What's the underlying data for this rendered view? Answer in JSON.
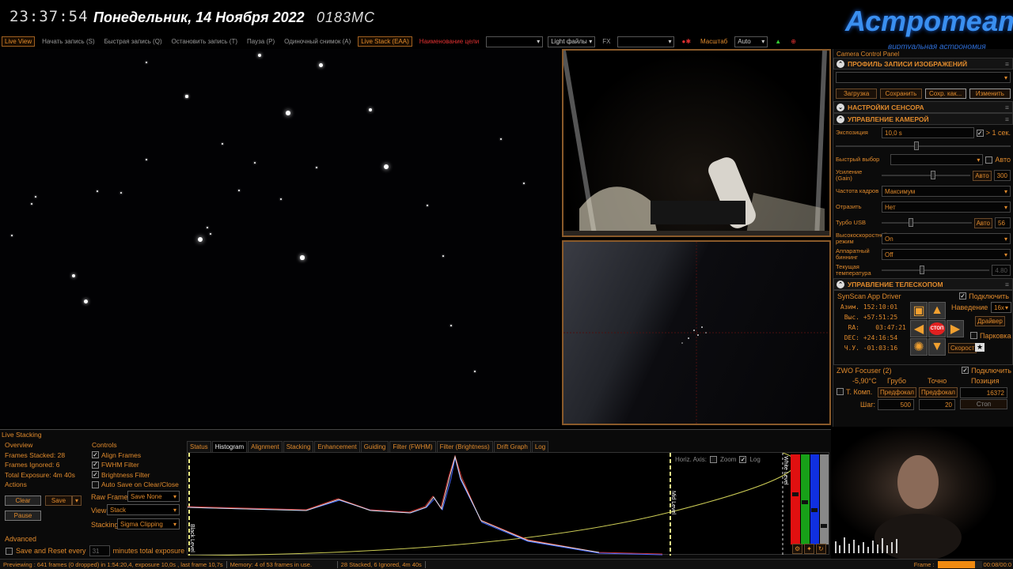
{
  "overlay": {
    "clock": "23:37:54",
    "date": "Понедельник, 14 Ноября 2022",
    "code": "0183МС",
    "logo": "Астротеатр",
    "logo_sub": "виртуальная астрономия"
  },
  "toolbar": {
    "live_view": "Live View",
    "start_rec": "Начать запись (S)",
    "quick_rec": "Быстрая запись (Q)",
    "stop_rec": "Остановить запись (T)",
    "pause": "Пауза (P)",
    "single_shot": "Одиночный снимок (A)",
    "live_stack": "Live Stack (EAA)",
    "target_name": "Наименование цели",
    "target_value": "",
    "light_files": "Light файлы",
    "fx": "FX",
    "fx_value": "",
    "scale_label": "Масштаб",
    "scale_value": "Auto"
  },
  "panel": {
    "title": "Camera Control Panel",
    "profile": {
      "title": "ПРОФИЛЬ ЗАПИСИ ИЗОБРАЖЕНИЙ",
      "value": "",
      "buttons": [
        "Загрузка",
        "Сохранить",
        "Сохр. как...",
        "Изменить"
      ]
    },
    "sensor": {
      "title": "НАСТРОЙКИ СЕНСОРА"
    },
    "camera": {
      "title": "УПРАВЛЕНИЕ КАМЕРОЙ",
      "exposure_label": "Экспозиция",
      "exposure": "10,0 s",
      "gt1_label": "> 1 сек.",
      "quick_label": "Быстрый выбор",
      "quick_value": "",
      "auto_label": "Авто",
      "gain_label": "Усиление (Gain)",
      "gain_auto": "Авто",
      "gain": "300",
      "gain_fraction": 0.55,
      "fps_label": "Частота кадров",
      "fps": "Максимум",
      "flip_label": "Отразить",
      "flip": "Нет",
      "usb_label": "Турбо USB",
      "usb_auto": "Авто",
      "usb": "56",
      "usb_fraction": 0.3,
      "hs_label": "Высокоскоростной режим",
      "hs": "On",
      "bin_label": "Аппаратный биннинг",
      "bin": "Off",
      "temp_label": "Текущая температура",
      "temp": "4.80",
      "temp_fraction": 0.35,
      "exposure_fraction": 0.45
    },
    "telescope": {
      "title": "УПРАВЛЕНИЕ ТЕЛЕСКОПОМ",
      "driver": "SynScan App Driver",
      "connect": "Подключить",
      "az_label": "Азим.",
      "az": "152:10:01",
      "alt_label": "Выс.",
      "alt": "+57:51:25",
      "ra_label": "RA:",
      "ra": "03:47:21",
      "dec_label": "DEC:",
      "dec": "+24:16:54",
      "ha_label": "Ч.У.",
      "ha": "-01:03:16",
      "stop": "СТОП",
      "goto_label": "Наведение",
      "goto_rate": "16x",
      "driver_btn": "Драйвер",
      "park": "Парковка",
      "speed": "Скорост"
    },
    "focuser": {
      "title": "ZWO Focuser (2)",
      "connect": "Подключить",
      "temp": "-5,90°C",
      "coarse": "Грубо",
      "fine": "Точно",
      "position_label": "Позиция",
      "tcomp": "Т. Комп.",
      "prefocal1": "Предфокал",
      "prefocal2": "Предфокал",
      "position": "16372",
      "step_label": "Шаг:",
      "coarse_step": "500",
      "fine_step": "20",
      "stop": "Стоп"
    }
  },
  "stacking": {
    "title": "Live Stacking",
    "overview_label": "Overview",
    "frames_stacked": "Frames Stacked: 28",
    "frames_ignored": "Frames Ignored: 6",
    "total_exposure": "Total Exposure:   4m 40s",
    "actions_label": "Actions",
    "clear": "Clear",
    "save": "Save",
    "pause": "Pause",
    "controls_label": "Controls",
    "align": "Align Frames",
    "fwhm": "FWHM Filter",
    "brightness": "Brightness Filter",
    "autosave": "Auto Save on Clear/Close",
    "raw_label": "Raw Frames",
    "raw": "Save None",
    "view_label": "View",
    "view": "Stack",
    "stacking_label": "Stacking",
    "stacking": "Sigma Clipping",
    "advanced_label": "Advanced",
    "save_reset": "Save and Reset every",
    "minutes_value": "31",
    "minutes_label": "minutes total exposure",
    "tabs": [
      "Status",
      "Histogram",
      "Alignment",
      "Stacking",
      "Enhancement",
      "Guiding",
      "Filter (FWHM)",
      "Filter (Brightness)",
      "Drift Graph",
      "Log"
    ],
    "active_tab": "Histogram",
    "hist": {
      "horiz_axis": "Horiz. Axis:",
      "zoom": "Zoom",
      "log": "Log",
      "black": "Black Level",
      "mid": "Mid Level",
      "white": "White Level"
    }
  },
  "statusbar": {
    "preview": "Previewing : 641 frames (0 dropped) in 1:54:20,4, exposure 10,0s , last frame 10,7s",
    "memory": "Memory: 4 of 53 frames in use.",
    "stacked": "28 Stacked, 6 Ignored, 4m 40s",
    "frame_label": "Frame :",
    "frame_time": "00:08/00:0"
  },
  "colors": {
    "accent": "#e08a2c",
    "logo": "#3a8ff0"
  }
}
